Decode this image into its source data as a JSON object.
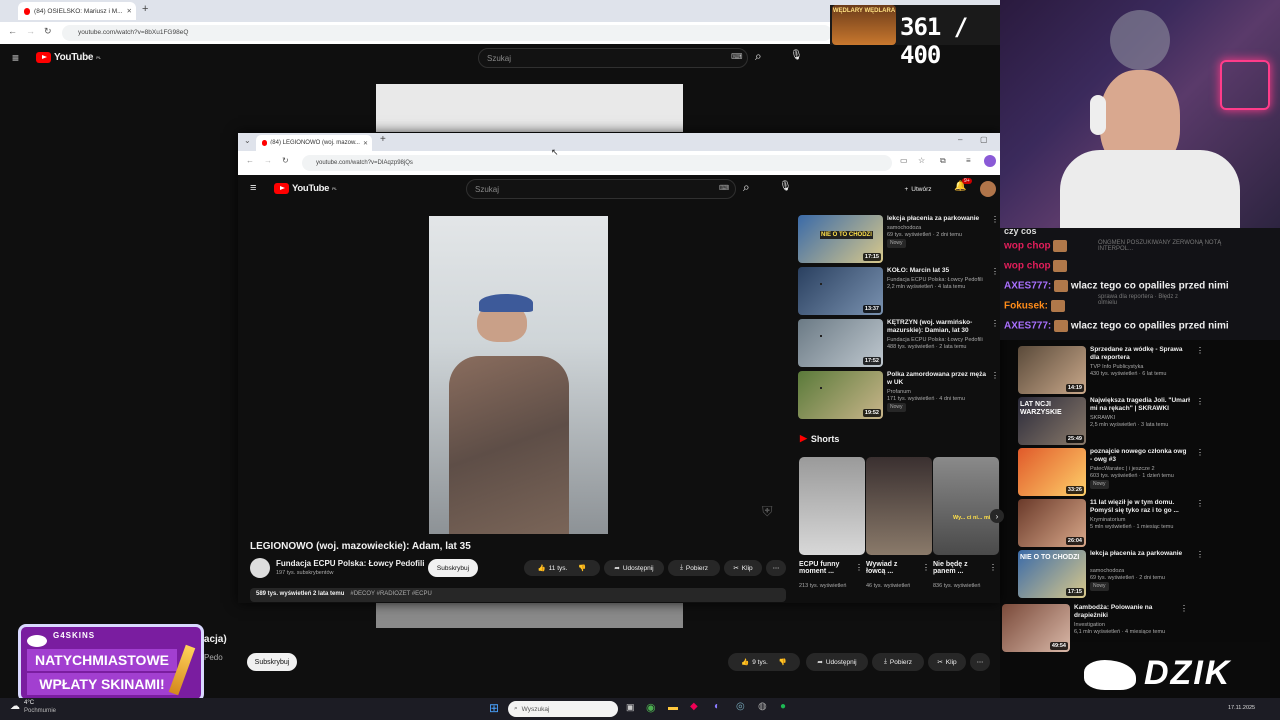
{
  "bg_window": {
    "tab_title": "(84) OSIELSKO: Mariusz i M...",
    "url": "youtube.com/watch?v=8bXu1FG98eQ",
    "search_placeholder": "Szukaj",
    "subscribe": "Subskrybuj",
    "channel_partial": "racja)",
    "channel_partial2": "Pedo",
    "likes": "9 tys.",
    "share": "Udostępnij",
    "download": "Pobierz",
    "clip": "Klip"
  },
  "overlay_counter": "361 / 400",
  "overlay_badge": "WĘDLARY WĘDLARA",
  "fg_window": {
    "tab_title": "(84) LEGIONOWO (woj. mazow...",
    "url": "youtube.com/watch?v=DIAqzp98jQs",
    "search_placeholder": "Szukaj",
    "create": "Utwórz",
    "notif_count": "9+",
    "video_title": "LEGIONOWO (woj. mazowieckie): Adam, lat 35",
    "channel_name": "Fundacja ECPU Polska: Łowcy Pedofili",
    "subscribers": "197 tys. subskrybentów",
    "subscribe": "Subskrybuj",
    "likes": "11 tys.",
    "share": "Udostępnij",
    "download": "Pobierz",
    "clip": "Klip",
    "views_line": "589 tys. wyświetleń  2 lata temu",
    "hashtags": "#DECOY #RADIOZET #ECPU",
    "related": [
      {
        "title": "lekcja płacenia za parkowanie",
        "channel": "samochodoza",
        "meta": "69 tys. wyświetleń · 2 dni temu",
        "badge": "Nowy",
        "duration": "17:15",
        "thumb_text": "NIE O TO CHODZI"
      },
      {
        "title": "KOŁO: Marcin lat 35",
        "channel": "Fundacja ECPU Polska: Łowcy Pedofili",
        "meta": "2,2 mln wyświetleń · 4 lata temu",
        "badge": "",
        "duration": "13:37",
        "thumb_text": ""
      },
      {
        "title": "KĘTRZYN (woj. warmińsko-mazurskie): Damian, lat 30",
        "channel": "Fundacja ECPU Polska: Łowcy Pedofili",
        "meta": "488 tys. wyświetleń · 2 lata temu",
        "badge": "",
        "duration": "17:52",
        "thumb_text": ""
      },
      {
        "title": "Polka zamordowana przez męża w UK",
        "channel": "Profanum",
        "meta": "171 tys. wyświetleń · 4 dni temu",
        "badge": "Nowy",
        "duration": "19:52",
        "thumb_text": ""
      }
    ],
    "shorts_label": "Shorts",
    "shorts": [
      {
        "title": "ECPU funny moment ...",
        "views": "213 tys. wyświetleń"
      },
      {
        "title": "Wywiad z łowcą ...",
        "views": "46 tys. wyświetleń"
      },
      {
        "title": "Nie będę z panem ...",
        "views": "836 tys. wyświetleń",
        "thumb_text": "Wy... ci ni... mi..."
      }
    ]
  },
  "chat": {
    "header": "czy cos",
    "lines": [
      {
        "user": "wop chop",
        "text": "",
        "color": "#e01e5a"
      },
      {
        "user": "wop chop",
        "text": "",
        "color": "#e01e5a"
      },
      {
        "user": "AXES777:",
        "text": "wlacz tego co opaliles przed nimi",
        "color": "#a970ff"
      },
      {
        "user": "Fokusek:",
        "text": "",
        "color": "#ff8c1a"
      },
      {
        "user": "AXES777:",
        "text": "wlacz tego co opaliles przed nimi",
        "color": "#a970ff"
      }
    ],
    "bg_items": [
      "ONGMEN POSZUKIWANY ZERWONĄ NOTĄ INTERPOL...",
      "sprawa dla reportera · Błędz z olmielu"
    ]
  },
  "right_list": [
    {
      "title": "Sprzedane za wódkę - Sprawa dla reportera",
      "channel": "TVP Info Publicystyka",
      "meta": "430 tys. wyświetleń · 6 lat temu",
      "badge": "",
      "duration": "14:19",
      "thumb_text": ""
    },
    {
      "title": "Największa tragedia Joli. \"Umarł mi na rękach\" | SKRAWKI",
      "channel": "SKRAWKI",
      "meta": "2,5 mln wyświetleń · 3 lata temu",
      "badge": "",
      "duration": "25:49",
      "thumb_text": "LAT NCJI WARZYSKIE"
    },
    {
      "title": "poznajcie nowego członka owg - owg #3",
      "channel": "PatecWaratec | i jeszcze 2",
      "meta": "603 tys. wyświetleń · 1 dzień temu",
      "badge": "Nowy",
      "duration": "33:26",
      "thumb_text": ""
    },
    {
      "title": "11 lat więził je w tym domu. Pomyśl się tyko raz i to go ...",
      "channel": "Kryminatorium",
      "meta": "5 mln wyświetleń · 1 miesiąc temu",
      "badge": "",
      "duration": "26:04",
      "thumb_text": ""
    },
    {
      "title": "lekcja płacenia za parkowanie",
      "channel": "samochodoza",
      "meta": "69 tys. wyświetleń · 2 dni temu",
      "badge": "Nowy",
      "duration": "17:15",
      "thumb_text": "NIE O TO CHODZI"
    },
    {
      "title": "Kambodża: Polowanie na drapieżniki",
      "channel": "Investigation",
      "meta": "6,1 mln wyświetleń · 4 miesiące temu",
      "badge": "",
      "duration": "49:54",
      "thumb_text": ""
    }
  ],
  "promo": {
    "brand": "G4SKINS",
    "line1": "NATYCHMIASTOWE",
    "line2": "WPŁATY SKINAMI!"
  },
  "dzik_logo": "DZIK",
  "taskbar": {
    "weather_temp": "4°C",
    "weather_desc": "Pochmurnie",
    "search_placeholder": "Wyszukaj",
    "date": "17.11.2025"
  },
  "colors": {
    "yt_red": "#ff0000",
    "promo_purple": "#7a1da0",
    "chat_purple": "#a970ff"
  }
}
